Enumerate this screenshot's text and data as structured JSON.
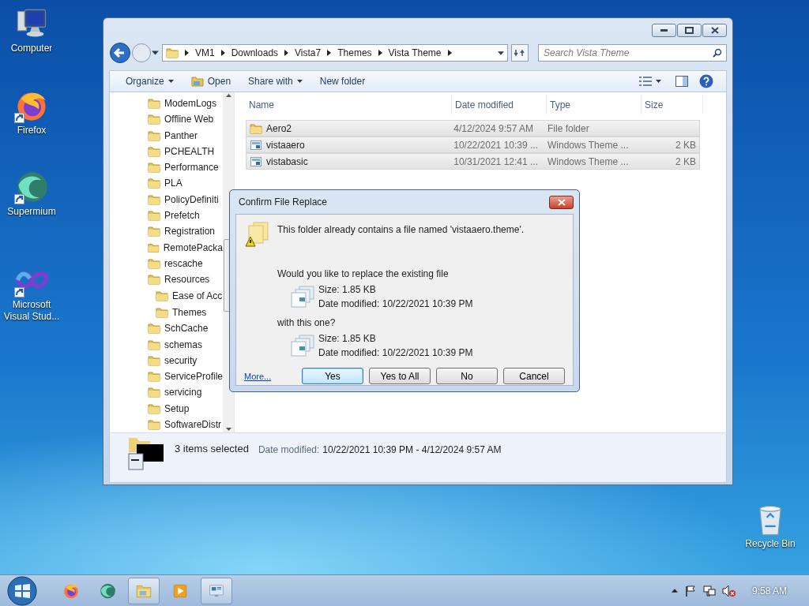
{
  "desktop_icons": [
    {
      "label": "Computer",
      "kind": "computer",
      "shortcut": false
    },
    {
      "label": "Firefox",
      "kind": "firefox",
      "shortcut": true
    },
    {
      "label": "Supermium",
      "kind": "supermium",
      "shortcut": true
    },
    {
      "label": "Microsoft Visual Stud...",
      "kind": "visualstudio",
      "shortcut": true
    },
    {
      "label": "Recycle Bin",
      "kind": "recyclebin",
      "shortcut": false
    }
  ],
  "explorer": {
    "address": {
      "path": [
        "VM1",
        "Downloads",
        "Vista7",
        "Themes",
        "Vista Theme"
      ]
    },
    "search": {
      "placeholder": "Search Vista Theme"
    },
    "toolbar": [
      {
        "label": "Organize",
        "dropdown": true,
        "kind": "plain"
      },
      {
        "label": "Open",
        "dropdown": false,
        "kind": "open"
      },
      {
        "label": "Share with",
        "dropdown": true,
        "kind": "plain"
      },
      {
        "label": "New folder",
        "dropdown": false,
        "kind": "plain"
      }
    ],
    "nav_tree": [
      {
        "label": "ModemLogs"
      },
      {
        "label": "Offline Web"
      },
      {
        "label": "Panther"
      },
      {
        "label": "PCHEALTH"
      },
      {
        "label": "Performance"
      },
      {
        "label": "PLA"
      },
      {
        "label": "PolicyDefiniti"
      },
      {
        "label": "Prefetch"
      },
      {
        "label": "Registration"
      },
      {
        "label": "RemotePacka"
      },
      {
        "label": "rescache"
      },
      {
        "label": "Resources",
        "children": [
          {
            "label": "Ease of Acc"
          },
          {
            "label": "Themes"
          }
        ]
      },
      {
        "label": "SchCache"
      },
      {
        "label": "schemas"
      },
      {
        "label": "security"
      },
      {
        "label": "ServiceProfile"
      },
      {
        "label": "servicing"
      },
      {
        "label": "Setup"
      },
      {
        "label": "SoftwareDistr"
      }
    ],
    "columns": [
      "Name",
      "Date modified",
      "Type",
      "Size"
    ],
    "files": [
      {
        "name": "Aero2",
        "date": "4/12/2024 9:57 AM",
        "type": "File folder",
        "kind": "folder",
        "selected": true
      },
      {
        "name": "vistaaero",
        "date": "10/22/2021 10:39 ...",
        "type": "Windows Theme ...",
        "size": "2 KB",
        "kind": "theme",
        "selected": true
      },
      {
        "name": "vistabasic",
        "date": "10/31/2021 12:41 ...",
        "type": "Windows Theme ...",
        "size": "2 KB",
        "kind": "theme",
        "selected": true
      }
    ],
    "details": {
      "summary": "3 items selected",
      "label": "Date modified:",
      "value": "10/22/2021 10:39 PM - 4/12/2024 9:57 AM"
    }
  },
  "dialog": {
    "title": "Confirm File Replace",
    "message": "This folder already contains a file named 'vistaaero.theme'.",
    "question": "Would you like to replace the existing file",
    "existing": {
      "size": "Size: 1.85 KB",
      "date": "Date modified: 10/22/2021 10:39 PM"
    },
    "with_label": "with this one?",
    "replacement": {
      "size": "Size: 1.85 KB",
      "date": "Date modified: 10/22/2021 10:39 PM"
    },
    "link": "More...",
    "buttons": [
      {
        "label": "Yes",
        "default": true
      },
      {
        "label": "Yes to All",
        "default": false
      },
      {
        "label": "No",
        "default": false
      },
      {
        "label": "Cancel",
        "default": false
      }
    ]
  },
  "taskbar": {
    "apps": [
      {
        "kind": "firefox",
        "running": false
      },
      {
        "kind": "supermium",
        "running": false
      },
      {
        "kind": "explorer",
        "running": true
      },
      {
        "kind": "mediaplayer",
        "running": false
      },
      {
        "kind": "remotedesktop",
        "running": true
      }
    ],
    "clock": "9:58 AM"
  }
}
